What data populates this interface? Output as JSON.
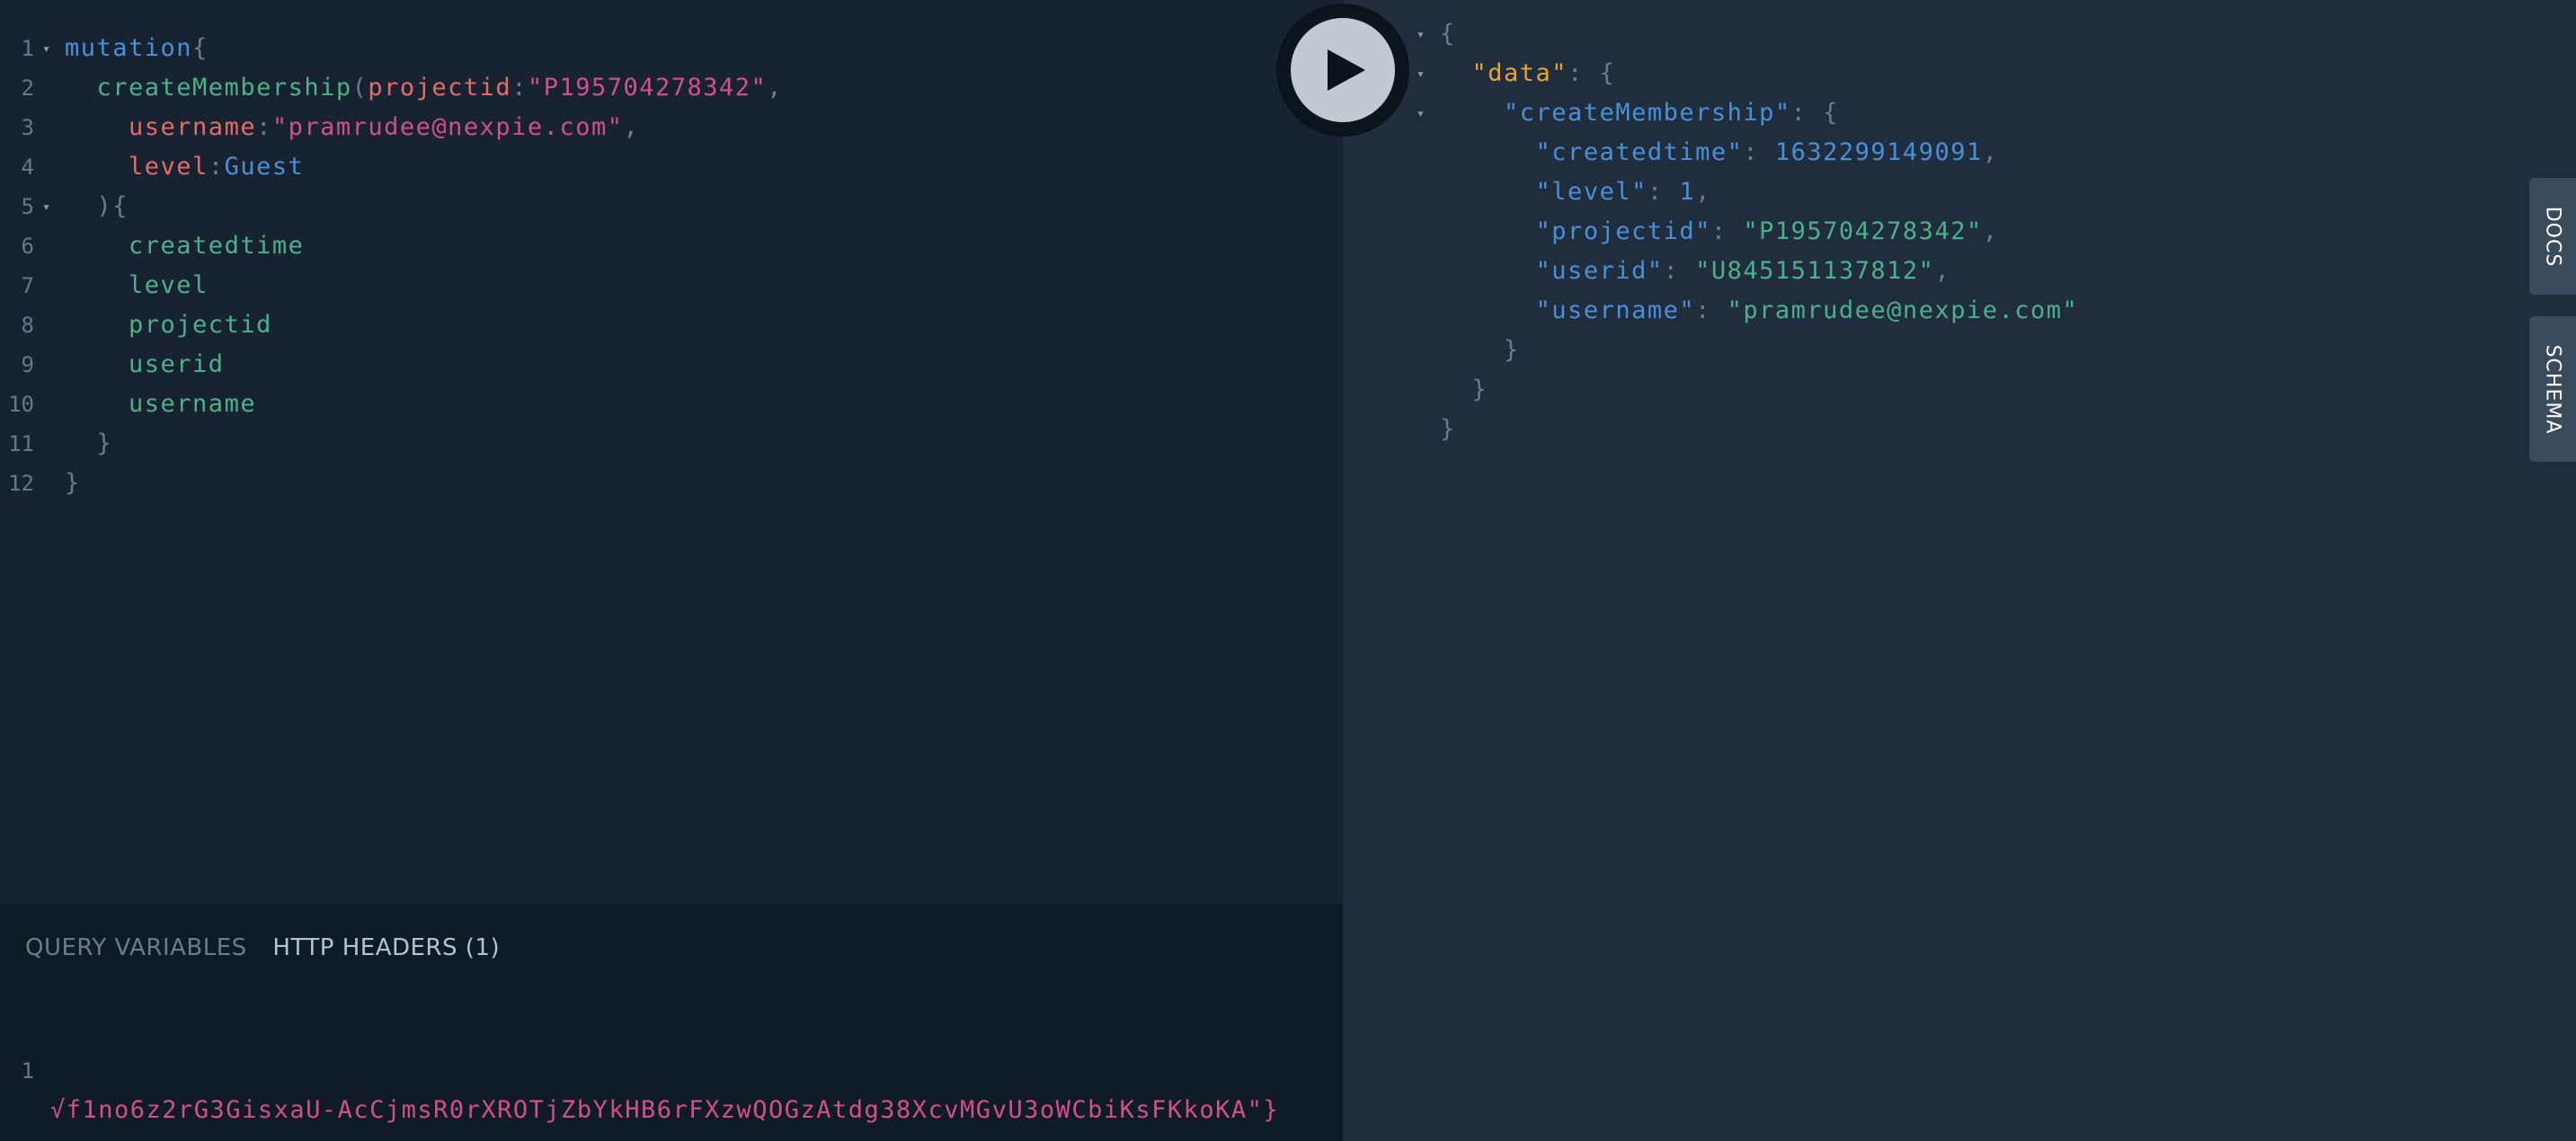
{
  "query_editor": {
    "lines": [
      {
        "n": "1",
        "fold": "▾",
        "parts": [
          [
            "c-kw",
            "mutation"
          ],
          [
            "c-punc",
            "{"
          ]
        ]
      },
      {
        "n": "2",
        "fold": "",
        "parts": [
          [
            "",
            "  "
          ],
          [
            "c-fn",
            "createMembership"
          ],
          [
            "c-punc",
            "("
          ],
          [
            "c-arg",
            "projectid"
          ],
          [
            "c-punc",
            ":"
          ],
          [
            "c-str",
            "\"P195704278342\""
          ],
          [
            "c-punc",
            ","
          ]
        ]
      },
      {
        "n": "3",
        "fold": "",
        "parts": [
          [
            "",
            "    "
          ],
          [
            "c-arg",
            "username"
          ],
          [
            "c-punc",
            ":"
          ],
          [
            "c-str",
            "\"pramrudee@nexpie.com\""
          ],
          [
            "c-punc",
            ","
          ]
        ]
      },
      {
        "n": "4",
        "fold": "",
        "parts": [
          [
            "",
            "    "
          ],
          [
            "c-arg",
            "level"
          ],
          [
            "c-punc",
            ":"
          ],
          [
            "c-enum",
            "Guest"
          ]
        ]
      },
      {
        "n": "5",
        "fold": "▾",
        "parts": [
          [
            "",
            "  "
          ],
          [
            "c-punc",
            "){"
          ]
        ]
      },
      {
        "n": "6",
        "fold": "",
        "parts": [
          [
            "",
            "    "
          ],
          [
            "c-field",
            "createdtime"
          ]
        ]
      },
      {
        "n": "7",
        "fold": "",
        "parts": [
          [
            "",
            "    "
          ],
          [
            "c-field",
            "level"
          ]
        ]
      },
      {
        "n": "8",
        "fold": "",
        "parts": [
          [
            "",
            "    "
          ],
          [
            "c-field",
            "projectid"
          ]
        ]
      },
      {
        "n": "9",
        "fold": "",
        "parts": [
          [
            "",
            "    "
          ],
          [
            "c-field",
            "userid"
          ]
        ]
      },
      {
        "n": "10",
        "fold": "",
        "parts": [
          [
            "",
            "    "
          ],
          [
            "c-field",
            "username"
          ]
        ]
      },
      {
        "n": "11",
        "fold": "",
        "parts": [
          [
            "",
            "  "
          ],
          [
            "c-punc",
            "}"
          ]
        ]
      },
      {
        "n": "12",
        "fold": "",
        "parts": [
          [
            "c-punc",
            "}"
          ]
        ]
      }
    ]
  },
  "variables_pane": {
    "tabs": [
      {
        "label": "QUERY VARIABLES",
        "active": false
      },
      {
        "label": "HTTP HEADERS (1)",
        "active": true
      }
    ],
    "line_number": "1",
    "header_text": "√f1no6z2rG3GisxaU-AcCjmsR0rXROTjZbYkHB6rFXzwQOGzAtdg38XcvMGvU3oWCbiKsFKkoKA\"}"
  },
  "result": {
    "lines": [
      {
        "fold": "▾",
        "parts": [
          [
            "r-punc",
            "{"
          ]
        ]
      },
      {
        "fold": "▾",
        "parts": [
          [
            "",
            "  "
          ],
          [
            "r-key-data",
            "\"data\""
          ],
          [
            "r-punc",
            ": {"
          ]
        ]
      },
      {
        "fold": "▾",
        "parts": [
          [
            "",
            "    "
          ],
          [
            "r-key",
            "\"createMembership\""
          ],
          [
            "r-punc",
            ": {"
          ]
        ]
      },
      {
        "fold": "",
        "parts": [
          [
            "",
            "      "
          ],
          [
            "r-key",
            "\"createdtime\""
          ],
          [
            "r-punc",
            ": "
          ],
          [
            "r-num",
            "1632299149091"
          ],
          [
            "r-punc",
            ","
          ]
        ]
      },
      {
        "fold": "",
        "parts": [
          [
            "",
            "      "
          ],
          [
            "r-key",
            "\"level\""
          ],
          [
            "r-punc",
            ": "
          ],
          [
            "r-num",
            "1"
          ],
          [
            "r-punc",
            ","
          ]
        ]
      },
      {
        "fold": "",
        "parts": [
          [
            "",
            "      "
          ],
          [
            "r-key",
            "\"projectid\""
          ],
          [
            "r-punc",
            ": "
          ],
          [
            "r-str",
            "\"P195704278342\""
          ],
          [
            "r-punc",
            ","
          ]
        ]
      },
      {
        "fold": "",
        "parts": [
          [
            "",
            "      "
          ],
          [
            "r-key",
            "\"userid\""
          ],
          [
            "r-punc",
            ": "
          ],
          [
            "r-str",
            "\"U845151137812\""
          ],
          [
            "r-punc",
            ","
          ]
        ]
      },
      {
        "fold": "",
        "parts": [
          [
            "",
            "      "
          ],
          [
            "r-key",
            "\"username\""
          ],
          [
            "r-punc",
            ": "
          ],
          [
            "r-str",
            "\"pramrudee@nexpie.com\""
          ]
        ]
      },
      {
        "fold": "",
        "parts": [
          [
            "",
            "    "
          ],
          [
            "r-punc",
            "}"
          ]
        ]
      },
      {
        "fold": "",
        "parts": [
          [
            "",
            "  "
          ],
          [
            "r-punc",
            "}"
          ]
        ]
      },
      {
        "fold": "",
        "parts": [
          [
            "r-punc",
            "}"
          ]
        ]
      }
    ]
  },
  "side_tabs": {
    "docs": "DOCS",
    "schema": "SCHEMA"
  },
  "icons": {
    "play": "play-icon",
    "fold": "fold-arrow-icon"
  },
  "colors": {
    "editor_bg": "#172330",
    "result_bg": "#1f2d3c",
    "variables_bg": "#0f1b25",
    "keyword": "#4a90d9",
    "string": "#d2508a",
    "field": "#4db08a"
  }
}
